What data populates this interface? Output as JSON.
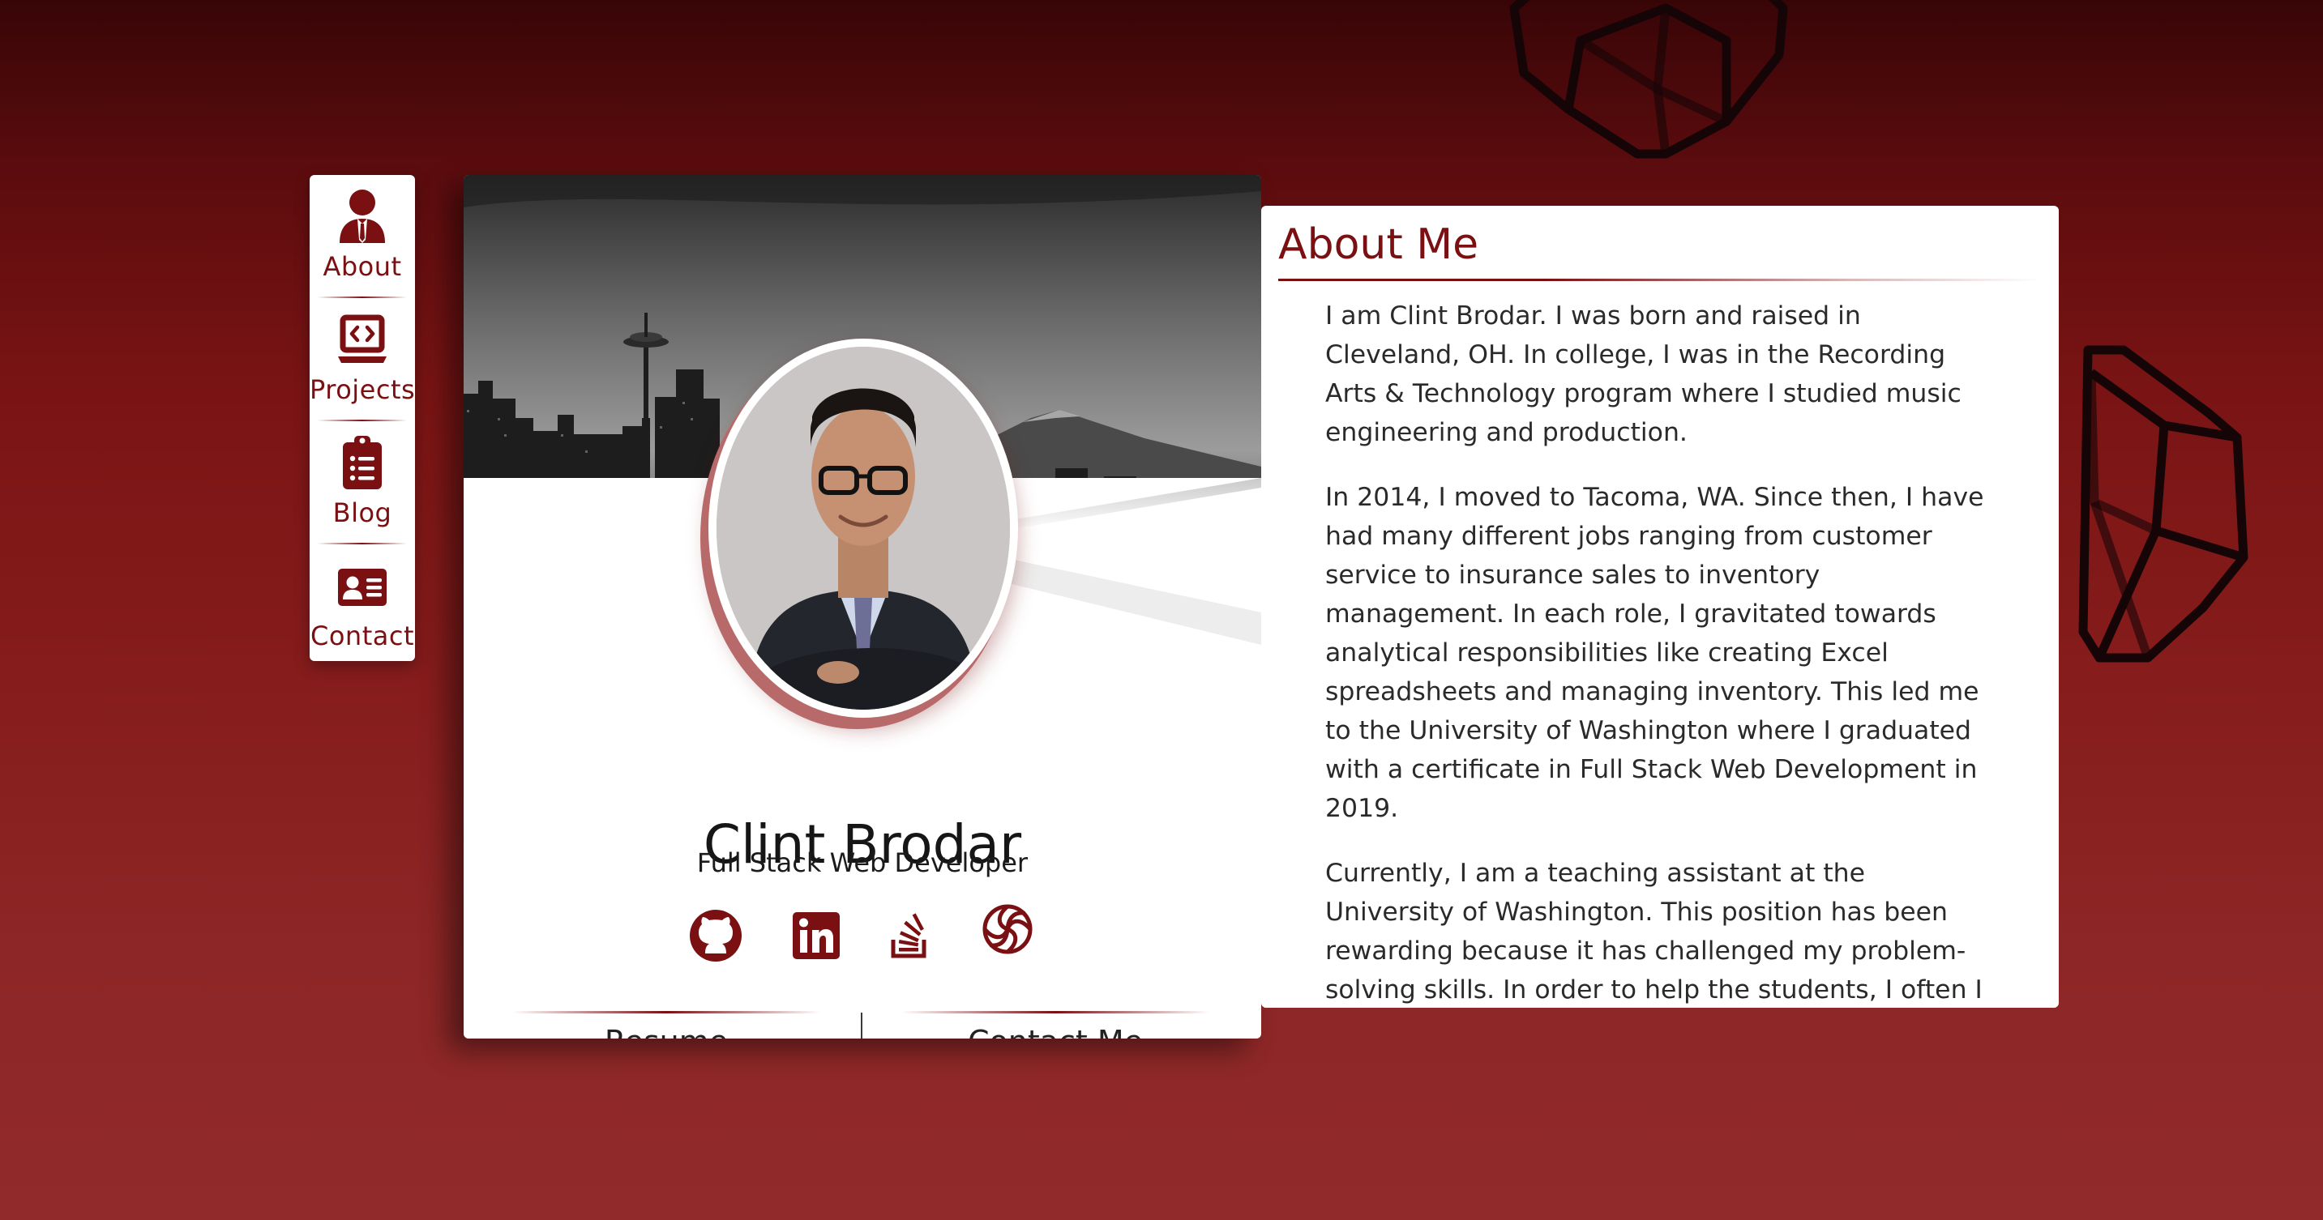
{
  "nav": {
    "items": [
      {
        "label": "About",
        "icon": "user-tie-icon"
      },
      {
        "label": "Projects",
        "icon": "laptop-code-icon"
      },
      {
        "label": "Blog",
        "icon": "clipboard-list-icon"
      },
      {
        "label": "Contact",
        "icon": "address-card-icon"
      }
    ]
  },
  "profile": {
    "name": "Clint Brodar",
    "title": "Full Stack Web Developer",
    "social": [
      {
        "icon": "github-icon"
      },
      {
        "icon": "linkedin-icon"
      },
      {
        "icon": "stack-overflow-icon"
      },
      {
        "icon": "codewars-icon"
      }
    ],
    "bottom_buttons": [
      {
        "label": "Resume"
      },
      {
        "label": "Contact Me"
      }
    ]
  },
  "about": {
    "title": "About Me",
    "paragraphs": [
      "I am Clint Brodar. I was born and raised in Cleveland, OH. In college, I was in the Recording Arts & Technology program where I studied music engineering and production.",
      "In 2014, I moved to Tacoma, WA. Since then, I have had many different jobs ranging from customer service to insurance sales to inventory management. In each role, I gravitated towards analytical responsibilities like creating Excel spreadsheets and managing inventory. This led me to the University of Washington where I graduated with a certificate in Full Stack Web Development in 2019.",
      "Currently, I am a teaching assistant at the University of Washington. This position has been rewarding because it has challenged my problem-solving skills. In order to help the students, I often I have to solve the same problem several different ways."
    ]
  },
  "colors": {
    "accent": "#7b1013",
    "background_top": "#380507",
    "background_bottom": "#912a2a"
  }
}
